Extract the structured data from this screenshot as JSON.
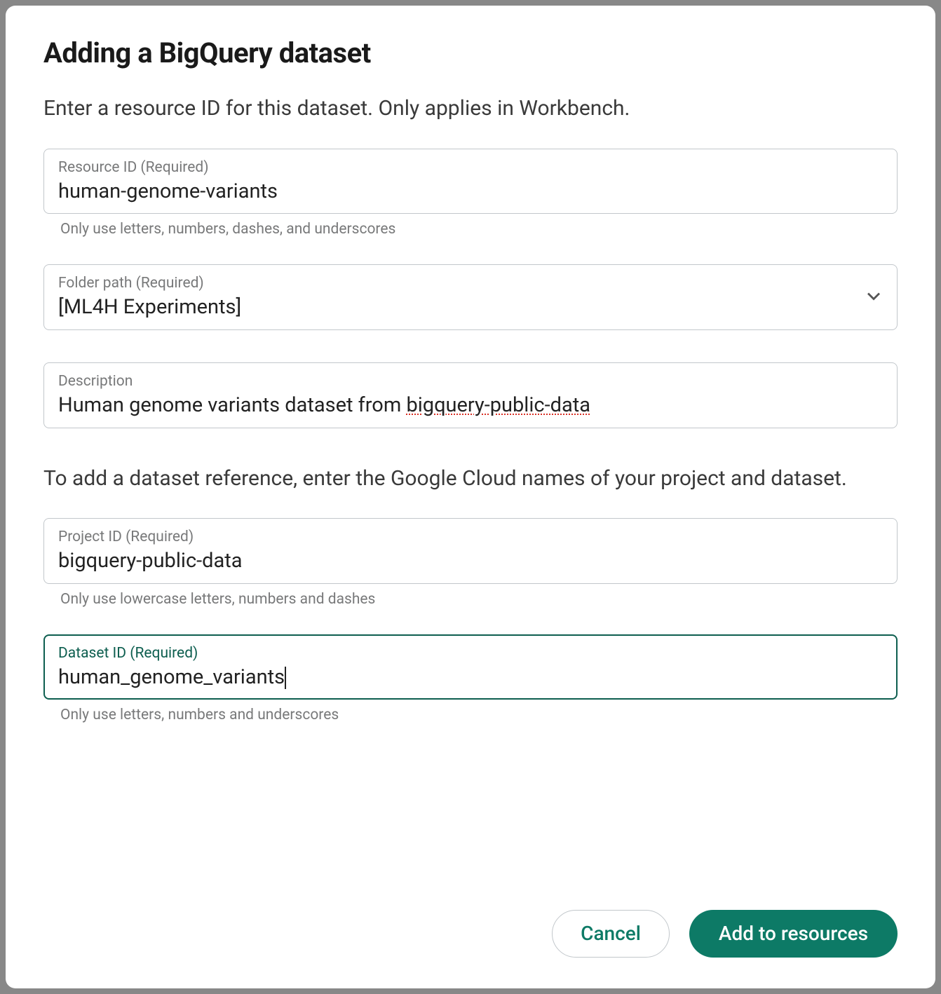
{
  "dialog": {
    "title": "Adding a BigQuery dataset",
    "instruction1": "Enter a resource ID for this dataset. Only applies in Workbench.",
    "instruction2": "To add a dataset reference, enter the Google Cloud names of your project and dataset."
  },
  "fields": {
    "resourceId": {
      "label": "Resource ID (Required)",
      "value": "human-genome-variants",
      "helper": "Only use letters, numbers, dashes, and underscores"
    },
    "folderPath": {
      "label": "Folder path (Required)",
      "value": "[ML4H Experiments]"
    },
    "description": {
      "label": "Description",
      "prefix": "Human genome variants dataset from ",
      "spellPart": "bigquery-public-data"
    },
    "projectId": {
      "label": "Project ID (Required)",
      "value": "bigquery-public-data",
      "helper": "Only use lowercase letters, numbers and dashes"
    },
    "datasetId": {
      "label": "Dataset ID (Required)",
      "value": "human_genome_variants",
      "helper": "Only use letters, numbers and underscores"
    }
  },
  "buttons": {
    "cancel": "Cancel",
    "add": "Add to resources"
  }
}
